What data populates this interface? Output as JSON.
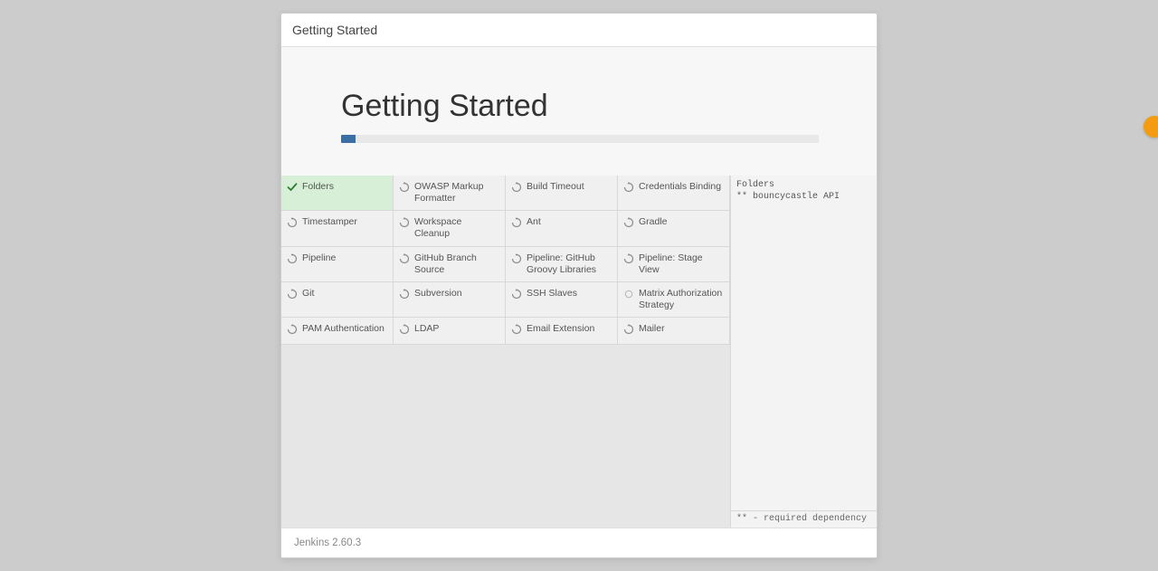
{
  "header": {
    "title": "Getting Started"
  },
  "hero": {
    "heading": "Getting Started",
    "progress_percent": 3
  },
  "plugins": [
    {
      "name": "Folders",
      "status": "done"
    },
    {
      "name": "OWASP Markup Formatter",
      "status": "pending"
    },
    {
      "name": "Build Timeout",
      "status": "pending"
    },
    {
      "name": "Credentials Binding",
      "status": "pending"
    },
    {
      "name": "Timestamper",
      "status": "pending"
    },
    {
      "name": "Workspace Cleanup",
      "status": "pending"
    },
    {
      "name": "Ant",
      "status": "pending"
    },
    {
      "name": "Gradle",
      "status": "pending"
    },
    {
      "name": "Pipeline",
      "status": "pending"
    },
    {
      "name": "GitHub Branch Source",
      "status": "pending"
    },
    {
      "name": "Pipeline: GitHub Groovy Libraries",
      "status": "pending"
    },
    {
      "name": "Pipeline: Stage View",
      "status": "pending"
    },
    {
      "name": "Git",
      "status": "pending"
    },
    {
      "name": "Subversion",
      "status": "pending"
    },
    {
      "name": "SSH Slaves",
      "status": "pending"
    },
    {
      "name": "Matrix Authorization Strategy",
      "status": "waiting"
    },
    {
      "name": "PAM Authentication",
      "status": "pending"
    },
    {
      "name": "LDAP",
      "status": "pending"
    },
    {
      "name": "Email Extension",
      "status": "pending"
    },
    {
      "name": "Mailer",
      "status": "pending"
    }
  ],
  "log": {
    "lines": "Folders\n** bouncycastle API",
    "footer": "** - required dependency"
  },
  "footer": {
    "version": "Jenkins 2.60.3"
  }
}
